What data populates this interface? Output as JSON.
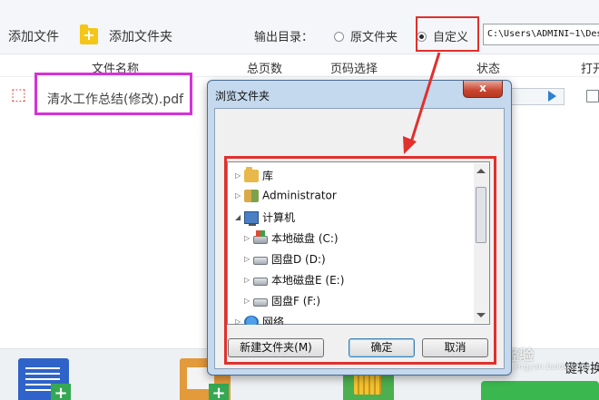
{
  "toolbar": {
    "add_file": "添加文件",
    "add_folder": "添加文件夹",
    "output_dir_label": "输出目录：",
    "option_original": "原文件夹",
    "option_custom": "自定义",
    "selected_option": "自定义",
    "path_value": "C:\\Users\\ADMINI~1\\Des"
  },
  "table": {
    "columns": [
      "文件名称",
      "总页数",
      "页码选择",
      "状态",
      "打开"
    ],
    "rows": [
      {
        "file_name": "清水工作总结(修改).pdf"
      }
    ]
  },
  "dialog": {
    "title": "浏览文件夹",
    "close_label": "x",
    "tree": [
      {
        "label": "库",
        "icon": "library-folder-icon"
      },
      {
        "label": "Administrator",
        "icon": "user-folder-icon"
      },
      {
        "label": "计算机",
        "icon": "computer-icon"
      },
      {
        "label": "本地磁盘 (C:)",
        "icon": "system-drive-icon"
      },
      {
        "label": "固盘D (D:)",
        "icon": "drive-icon"
      },
      {
        "label": "本地磁盘E (E:)",
        "icon": "drive-icon"
      },
      {
        "label": "固盘F (F:)",
        "icon": "drive-icon"
      },
      {
        "label": "网络",
        "icon": "network-icon"
      }
    ],
    "buttons": {
      "new_folder": "新建文件夹(M)",
      "ok": "确定",
      "cancel": "取消"
    }
  },
  "bottom": {
    "convert_label": "键转换"
  },
  "watermark": {
    "text": "Baidu经验",
    "sub": "jingyan.baidu.com"
  },
  "colors": {
    "highlight_red": "#e0302c",
    "highlight_magenta": "#d632d6",
    "dialog_frame": "#c4d8ee",
    "accent_green": "#3ab84f"
  }
}
